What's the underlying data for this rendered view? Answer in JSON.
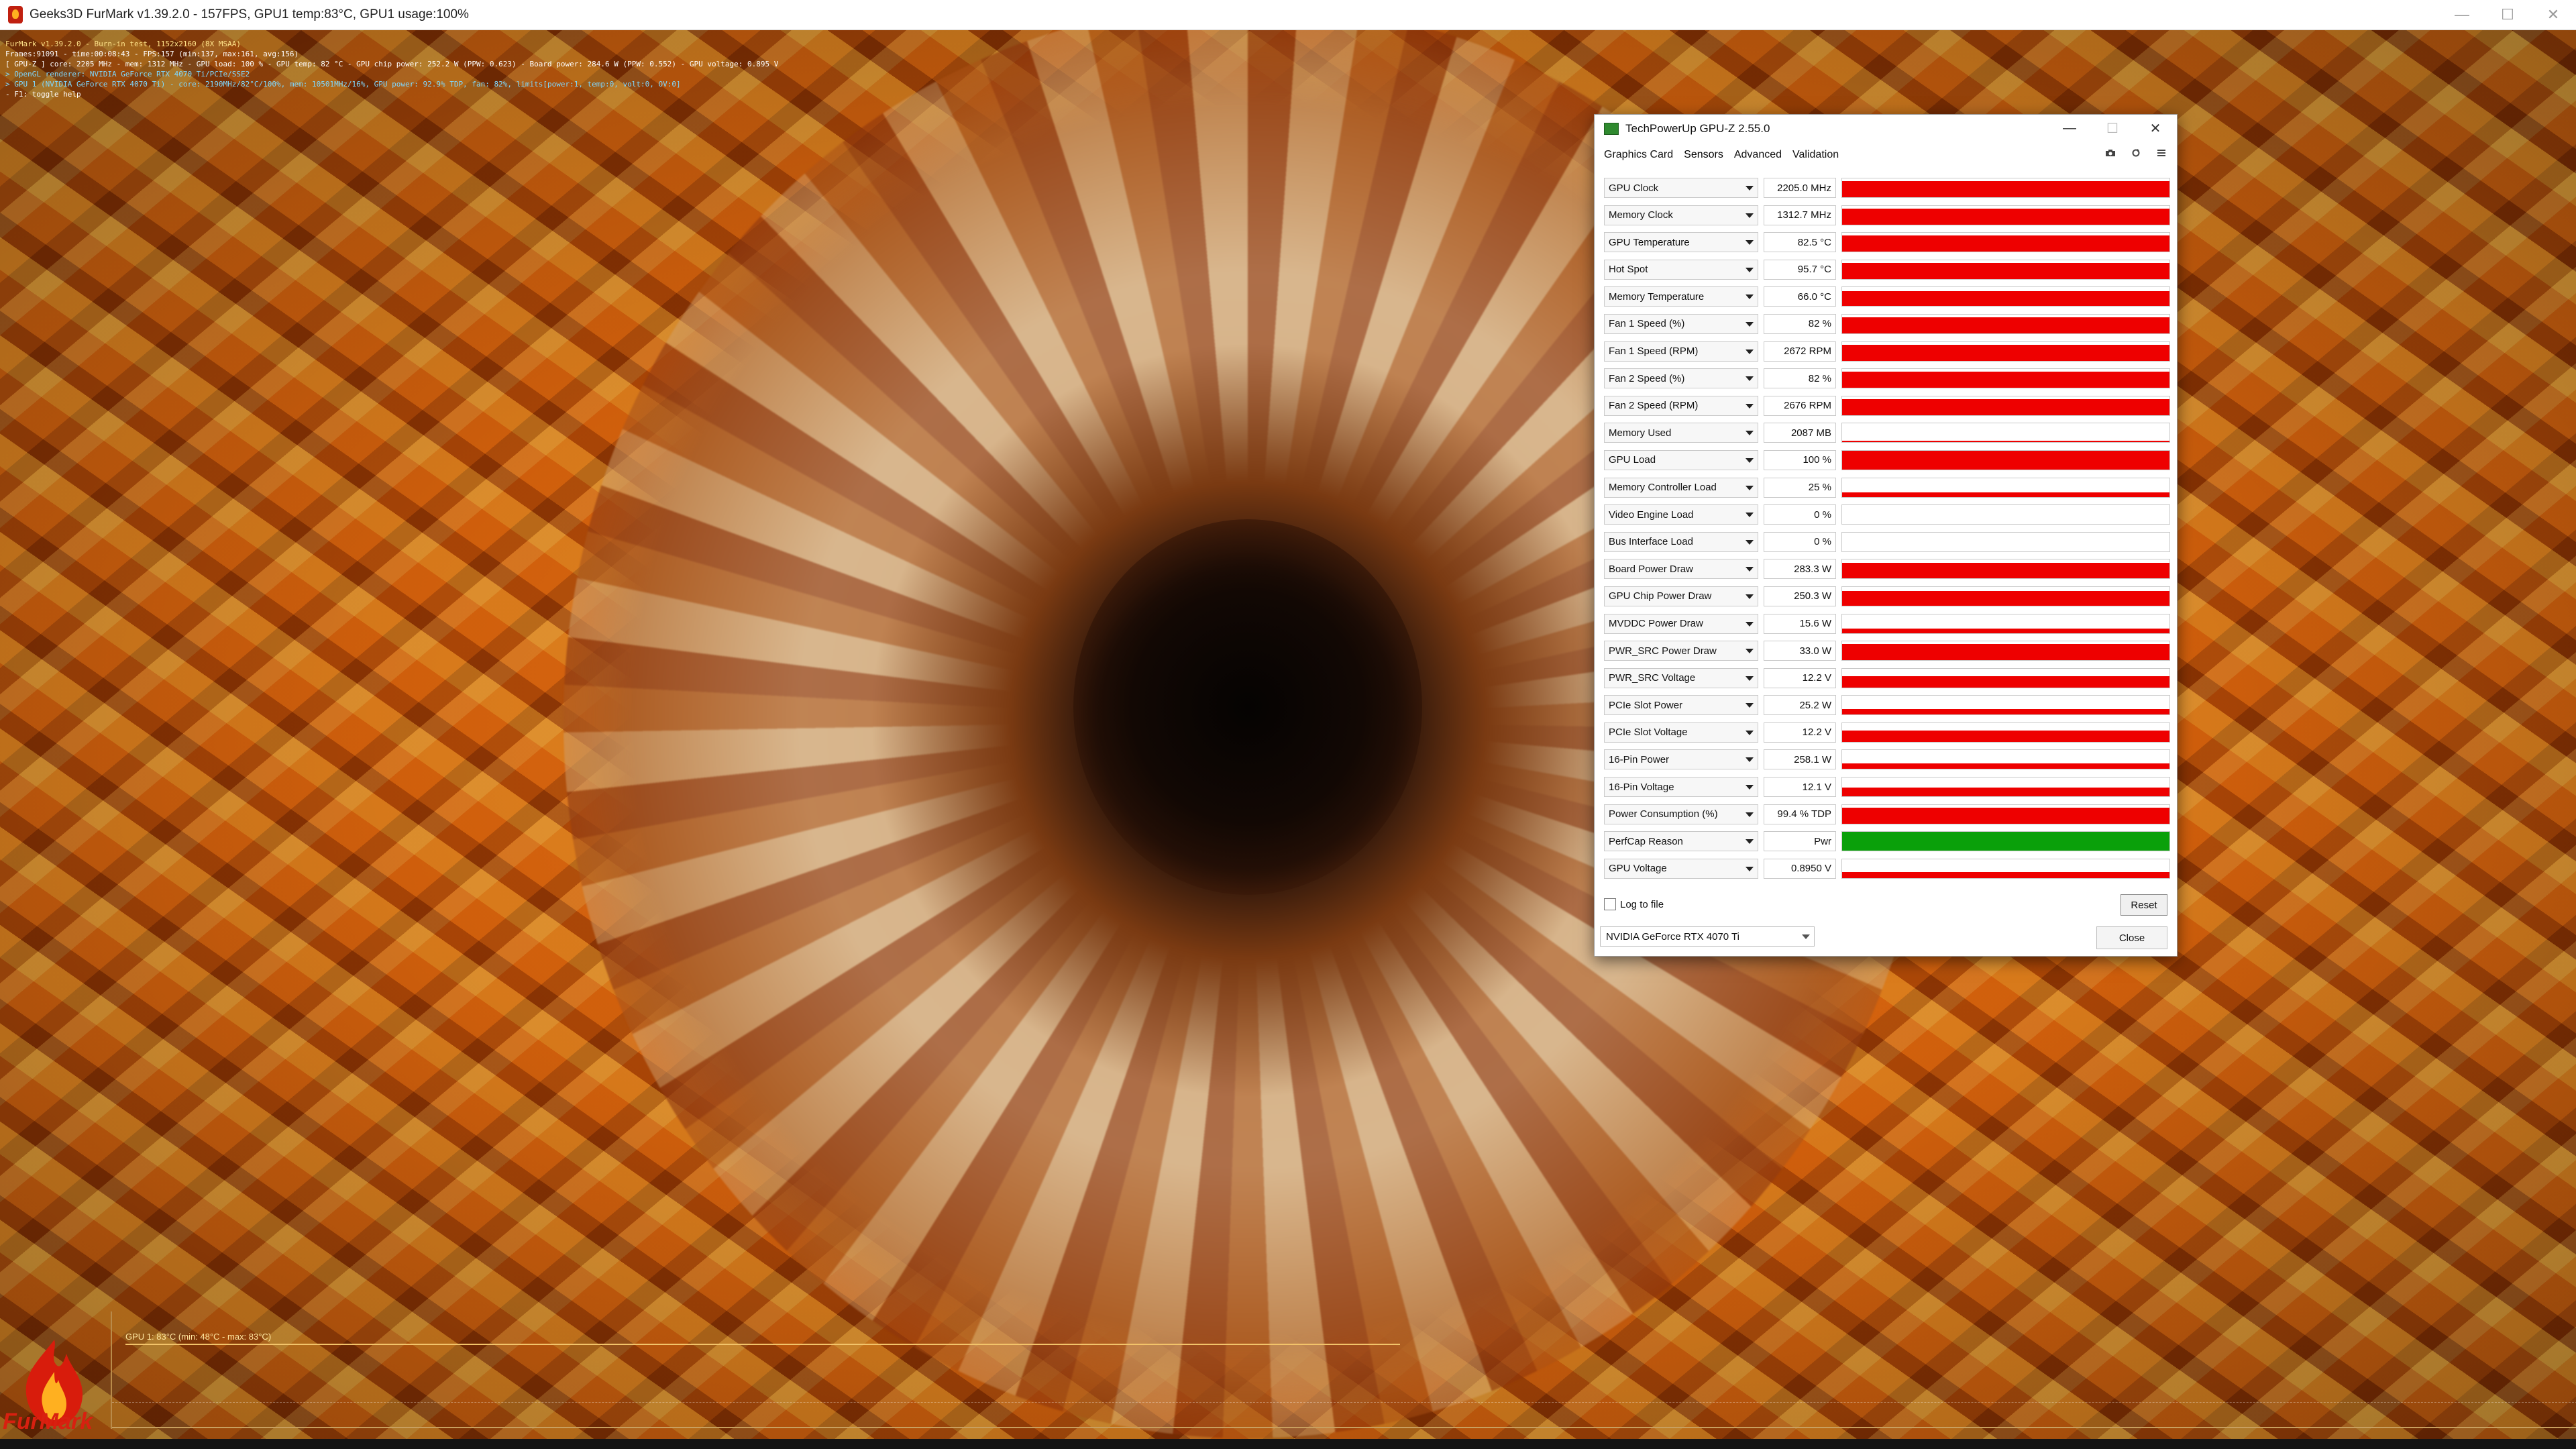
{
  "furmark": {
    "title": "Geeks3D FurMark v1.39.2.0 - 157FPS, GPU1 temp:83°C, GPU1 usage:100%",
    "osd_lines": [
      {
        "text": "FurMark v1.39.2.0 - Burn-in test, 1152x2160 (8X MSAA)",
        "color": "yellow"
      },
      {
        "text": "Frames:91091 - time:00:08:43 - FPS:157 (min:137, max:161, avg:156)",
        "color": "white"
      },
      {
        "text": "[ GPU-Z ] core: 2205 MHz - mem: 1312 MHz - GPU load: 100 % - GPU temp: 82 °C - GPU chip power: 252.2 W (PPW: 0.623) - Board power: 284.6 W (PPW: 0.552) - GPU voltage: 0.895 V",
        "color": "white"
      },
      {
        "text": "> OpenGL renderer: NVIDIA GeForce RTX 4070 Ti/PCIe/SSE2",
        "color": "cyan"
      },
      {
        "text": "> GPU 1 (NVIDIA GeForce RTX 4070 Ti) - core: 2190MHz/82°C/100%, mem: 10501MHz/16%, GPU power: 92.9% TDP, fan: 82%, limits[power:1, temp:0, volt:0, OV:0]",
        "color": "cyan"
      },
      {
        "text": "- F1: toggle help",
        "color": "white"
      }
    ],
    "graph_label": "GPU 1: 83°C (min: 48°C - max: 83°C)",
    "logo_text": "FurMark",
    "window_controls": [
      "—",
      "☐",
      "✕"
    ]
  },
  "gpuz": {
    "title": "TechPowerUp GPU-Z 2.55.0",
    "tabs": [
      "Graphics Card",
      "Sensors",
      "Advanced",
      "Validation"
    ],
    "active_tab": "Sensors",
    "sensors": [
      {
        "name": "GPU Clock",
        "value": "2205.0 MHz",
        "fill": 0.85,
        "color": "#ee0000"
      },
      {
        "name": "Memory Clock",
        "value": "1312.7 MHz",
        "fill": 0.85,
        "color": "#ee0000"
      },
      {
        "name": "GPU Temperature",
        "value": "82.5 °C",
        "fill": 0.85,
        "color": "#ee0000"
      },
      {
        "name": "Hot Spot",
        "value": "95.7 °C",
        "fill": 0.85,
        "color": "#ee0000"
      },
      {
        "name": "Memory Temperature",
        "value": "66.0 °C",
        "fill": 0.8,
        "color": "#ee0000"
      },
      {
        "name": "Fan 1 Speed (%)",
        "value": "82 %",
        "fill": 0.85,
        "color": "#ee0000"
      },
      {
        "name": "Fan 1 Speed (RPM)",
        "value": "2672 RPM",
        "fill": 0.85,
        "color": "#ee0000"
      },
      {
        "name": "Fan 2 Speed (%)",
        "value": "82 %",
        "fill": 0.85,
        "color": "#ee0000"
      },
      {
        "name": "Fan 2 Speed (RPM)",
        "value": "2676 RPM",
        "fill": 0.85,
        "color": "#ee0000"
      },
      {
        "name": "Memory Used",
        "value": "2087 MB",
        "fill": 0.08,
        "color": "#ee0000"
      },
      {
        "name": "GPU Load",
        "value": "100 %",
        "fill": 1.0,
        "color": "#ee0000"
      },
      {
        "name": "Memory Controller Load",
        "value": "25 %",
        "fill": 0.25,
        "color": "#ee0000"
      },
      {
        "name": "Video Engine Load",
        "value": "0 %",
        "fill": 0.0,
        "color": "#ee0000"
      },
      {
        "name": "Bus Interface Load",
        "value": "0 %",
        "fill": 0.0,
        "color": "#ee0000"
      },
      {
        "name": "Board Power Draw",
        "value": "283.3 W",
        "fill": 0.85,
        "color": "#ee0000"
      },
      {
        "name": "GPU Chip Power Draw",
        "value": "250.3 W",
        "fill": 0.8,
        "color": "#ee0000"
      },
      {
        "name": "MVDDC Power Draw",
        "value": "15.6 W",
        "fill": 0.25,
        "color": "#ee0000"
      },
      {
        "name": "PWR_SRC Power Draw",
        "value": "33.0 W",
        "fill": 0.85,
        "color": "#ee0000"
      },
      {
        "name": "PWR_SRC Voltage",
        "value": "12.2 V",
        "fill": 0.6,
        "color": "#ee0000"
      },
      {
        "name": "PCIe Slot Power",
        "value": "25.2 W",
        "fill": 0.3,
        "color": "#ee0000"
      },
      {
        "name": "PCIe Slot Voltage",
        "value": "12.2 V",
        "fill": 0.6,
        "color": "#ee0000"
      },
      {
        "name": "16-Pin Power",
        "value": "258.1 W",
        "fill": 0.3,
        "color": "#ee0000"
      },
      {
        "name": "16-Pin Voltage",
        "value": "12.1 V",
        "fill": 0.45,
        "color": "#ee0000"
      },
      {
        "name": "Power Consumption (%)",
        "value": "99.4 % TDP",
        "fill": 0.85,
        "color": "#ee0000"
      },
      {
        "name": "PerfCap Reason",
        "value": "Pwr",
        "fill": 1.0,
        "color": "#0aa00a"
      },
      {
        "name": "GPU Voltage",
        "value": "0.8950 V",
        "fill": 0.3,
        "color": "#ee0000"
      }
    ],
    "log_label": "Log to file",
    "reset_label": "Reset",
    "device_select": "NVIDIA GeForce RTX 4070 Ti",
    "close_label": "Close",
    "window_controls": [
      "—",
      "☐",
      "✕"
    ]
  }
}
